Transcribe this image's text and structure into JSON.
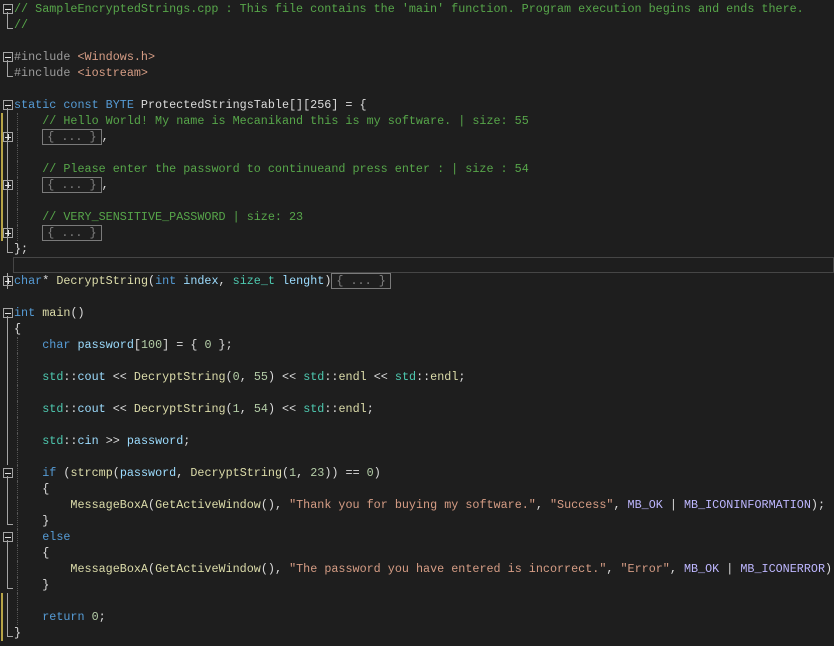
{
  "editor": {
    "theme": {
      "background": "#1e1e1e",
      "comment": "#57a64a",
      "keyword": "#569cd6",
      "function": "#dcdcaa",
      "string": "#d69d85",
      "macro": "#beb7ff"
    },
    "collapsed_label": "{ ... }",
    "lines": [
      {
        "fold": "minus",
        "tokens": [
          [
            "c",
            "// SampleEncryptedStrings.cpp : This file contains the 'main' function. Program execution begins and ends there."
          ]
        ]
      },
      {
        "fold": "end",
        "tokens": [
          [
            "c",
            "//"
          ]
        ]
      },
      {
        "fold": "",
        "tokens": []
      },
      {
        "fold": "minus",
        "tokens": [
          [
            "pp",
            "#include "
          ],
          [
            "s",
            "<Windows.h>"
          ]
        ]
      },
      {
        "fold": "end",
        "tokens": [
          [
            "pp",
            "#include "
          ],
          [
            "s",
            "<iostream>"
          ]
        ]
      },
      {
        "fold": "",
        "tokens": []
      },
      {
        "fold": "minus",
        "tokens": [
          [
            "k",
            "static const BYTE "
          ],
          [
            "p",
            "ProtectedStringsTable[][256] = {"
          ]
        ]
      },
      {
        "fold": "bar",
        "guide": true,
        "chg": true,
        "tokens": [
          [
            "p",
            "    "
          ],
          [
            "c",
            "// Hello World! My name is Mecanikand this is my software. | size: 55"
          ]
        ]
      },
      {
        "fold": "plus",
        "guide": true,
        "chg": true,
        "tokens": [
          [
            "p",
            "    "
          ],
          [
            "g",
            "{ ... }"
          ],
          [
            "p",
            ","
          ]
        ]
      },
      {
        "fold": "bar",
        "guide": true,
        "chg": true,
        "tokens": []
      },
      {
        "fold": "bar",
        "guide": true,
        "chg": true,
        "tokens": [
          [
            "p",
            "    "
          ],
          [
            "c",
            "// Please enter the password to continueand press enter : | size : 54"
          ]
        ]
      },
      {
        "fold": "plus",
        "guide": true,
        "chg": true,
        "tokens": [
          [
            "p",
            "    "
          ],
          [
            "g",
            "{ ... }"
          ],
          [
            "p",
            ","
          ]
        ]
      },
      {
        "fold": "bar",
        "guide": true,
        "chg": true,
        "tokens": []
      },
      {
        "fold": "bar",
        "guide": true,
        "chg": true,
        "tokens": [
          [
            "p",
            "    "
          ],
          [
            "c",
            "// VERY_SENSITIVE_PASSWORD | size: 23"
          ]
        ]
      },
      {
        "fold": "plus",
        "guide": true,
        "chg": true,
        "tokens": [
          [
            "p",
            "    "
          ],
          [
            "g",
            "{ ... }"
          ]
        ]
      },
      {
        "fold": "end",
        "tokens": [
          [
            "p",
            "};"
          ]
        ]
      },
      {
        "fold": "",
        "highlight": true,
        "tokens": []
      },
      {
        "fold": "plus",
        "tokens": [
          [
            "k",
            "char"
          ],
          [
            "p",
            "* "
          ],
          [
            "f",
            "DecryptString"
          ],
          [
            "p",
            "("
          ],
          [
            "k",
            "int "
          ],
          [
            "v",
            "index"
          ],
          [
            "p",
            ", "
          ],
          [
            "t",
            "size_t "
          ],
          [
            "v",
            "lenght"
          ],
          [
            "p",
            ")"
          ],
          [
            "g",
            "{ ... }"
          ]
        ]
      },
      {
        "fold": "",
        "tokens": []
      },
      {
        "fold": "minus",
        "tokens": [
          [
            "k",
            "int "
          ],
          [
            "f",
            "main"
          ],
          [
            "p",
            "()"
          ]
        ]
      },
      {
        "fold": "bar",
        "tokens": [
          [
            "p",
            "{"
          ]
        ]
      },
      {
        "fold": "bar",
        "guide": true,
        "tokens": [
          [
            "p",
            "    "
          ],
          [
            "k",
            "char "
          ],
          [
            "v",
            "password"
          ],
          [
            "p",
            "["
          ],
          [
            "n",
            "100"
          ],
          [
            "p",
            "] = { "
          ],
          [
            "n",
            "0"
          ],
          [
            "p",
            " };"
          ]
        ]
      },
      {
        "fold": "bar",
        "guide": true,
        "tokens": []
      },
      {
        "fold": "bar",
        "guide": true,
        "tokens": [
          [
            "p",
            "    "
          ],
          [
            "t",
            "std"
          ],
          [
            "p",
            "::"
          ],
          [
            "v",
            "cout"
          ],
          [
            "p",
            " << "
          ],
          [
            "f",
            "DecryptString"
          ],
          [
            "p",
            "("
          ],
          [
            "n",
            "0"
          ],
          [
            "p",
            ", "
          ],
          [
            "n",
            "55"
          ],
          [
            "p",
            ") << "
          ],
          [
            "t",
            "std"
          ],
          [
            "p",
            "::"
          ],
          [
            "f",
            "endl"
          ],
          [
            "p",
            " << "
          ],
          [
            "t",
            "std"
          ],
          [
            "p",
            "::"
          ],
          [
            "f",
            "endl"
          ],
          [
            "p",
            ";"
          ]
        ]
      },
      {
        "fold": "bar",
        "guide": true,
        "tokens": []
      },
      {
        "fold": "bar",
        "guide": true,
        "tokens": [
          [
            "p",
            "    "
          ],
          [
            "t",
            "std"
          ],
          [
            "p",
            "::"
          ],
          [
            "v",
            "cout"
          ],
          [
            "p",
            " << "
          ],
          [
            "f",
            "DecryptString"
          ],
          [
            "p",
            "("
          ],
          [
            "n",
            "1"
          ],
          [
            "p",
            ", "
          ],
          [
            "n",
            "54"
          ],
          [
            "p",
            ") << "
          ],
          [
            "t",
            "std"
          ],
          [
            "p",
            "::"
          ],
          [
            "f",
            "endl"
          ],
          [
            "p",
            ";"
          ]
        ]
      },
      {
        "fold": "bar",
        "guide": true,
        "tokens": []
      },
      {
        "fold": "bar",
        "guide": true,
        "tokens": [
          [
            "p",
            "    "
          ],
          [
            "t",
            "std"
          ],
          [
            "p",
            "::"
          ],
          [
            "v",
            "cin"
          ],
          [
            "p",
            " >> "
          ],
          [
            "v",
            "password"
          ],
          [
            "p",
            ";"
          ]
        ]
      },
      {
        "fold": "bar",
        "guide": true,
        "tokens": []
      },
      {
        "fold": "minus",
        "guide": true,
        "tokens": [
          [
            "p",
            "    "
          ],
          [
            "k",
            "if "
          ],
          [
            "p",
            "("
          ],
          [
            "f",
            "strcmp"
          ],
          [
            "p",
            "("
          ],
          [
            "v",
            "password"
          ],
          [
            "p",
            ", "
          ],
          [
            "f",
            "DecryptString"
          ],
          [
            "p",
            "("
          ],
          [
            "n",
            "1"
          ],
          [
            "p",
            ", "
          ],
          [
            "n",
            "23"
          ],
          [
            "p",
            ")) == "
          ],
          [
            "n",
            "0"
          ],
          [
            "p",
            ")"
          ]
        ]
      },
      {
        "fold": "bar",
        "guide": true,
        "tokens": [
          [
            "p",
            "    {"
          ]
        ]
      },
      {
        "fold": "bar",
        "guide": true,
        "tokens": [
          [
            "p",
            "        "
          ],
          [
            "f",
            "MessageBoxA"
          ],
          [
            "p",
            "("
          ],
          [
            "f",
            "GetActiveWindow"
          ],
          [
            "p",
            "(), "
          ],
          [
            "s",
            "\"Thank you for buying my software.\""
          ],
          [
            "p",
            ", "
          ],
          [
            "s",
            "\"Success\""
          ],
          [
            "p",
            ", "
          ],
          [
            "m",
            "MB_OK"
          ],
          [
            "p",
            " | "
          ],
          [
            "m",
            "MB_ICONINFORMATION"
          ],
          [
            "p",
            ");"
          ]
        ]
      },
      {
        "fold": "end",
        "guide": true,
        "tokens": [
          [
            "p",
            "    }"
          ]
        ]
      },
      {
        "fold": "minus",
        "guide": true,
        "tokens": [
          [
            "p",
            "    "
          ],
          [
            "k",
            "else"
          ]
        ]
      },
      {
        "fold": "bar",
        "guide": true,
        "tokens": [
          [
            "p",
            "    {"
          ]
        ]
      },
      {
        "fold": "bar",
        "guide": true,
        "tokens": [
          [
            "p",
            "        "
          ],
          [
            "f",
            "MessageBoxA"
          ],
          [
            "p",
            "("
          ],
          [
            "f",
            "GetActiveWindow"
          ],
          [
            "p",
            "(), "
          ],
          [
            "s",
            "\"The password you have entered is incorrect.\""
          ],
          [
            "p",
            ", "
          ],
          [
            "s",
            "\"Error\""
          ],
          [
            "p",
            ", "
          ],
          [
            "m",
            "MB_OK"
          ],
          [
            "p",
            " | "
          ],
          [
            "m",
            "MB_ICONERROR"
          ],
          [
            "p",
            ");"
          ]
        ]
      },
      {
        "fold": "end",
        "guide": true,
        "tokens": [
          [
            "p",
            "    }"
          ]
        ]
      },
      {
        "fold": "bar",
        "guide": true,
        "chg": true,
        "tokens": []
      },
      {
        "fold": "bar",
        "guide": true,
        "chg": true,
        "tokens": [
          [
            "p",
            "    "
          ],
          [
            "k",
            "return "
          ],
          [
            "n",
            "0"
          ],
          [
            "p",
            ";"
          ]
        ]
      },
      {
        "fold": "end",
        "chg": true,
        "tokens": [
          [
            "p",
            "}"
          ]
        ]
      }
    ]
  }
}
